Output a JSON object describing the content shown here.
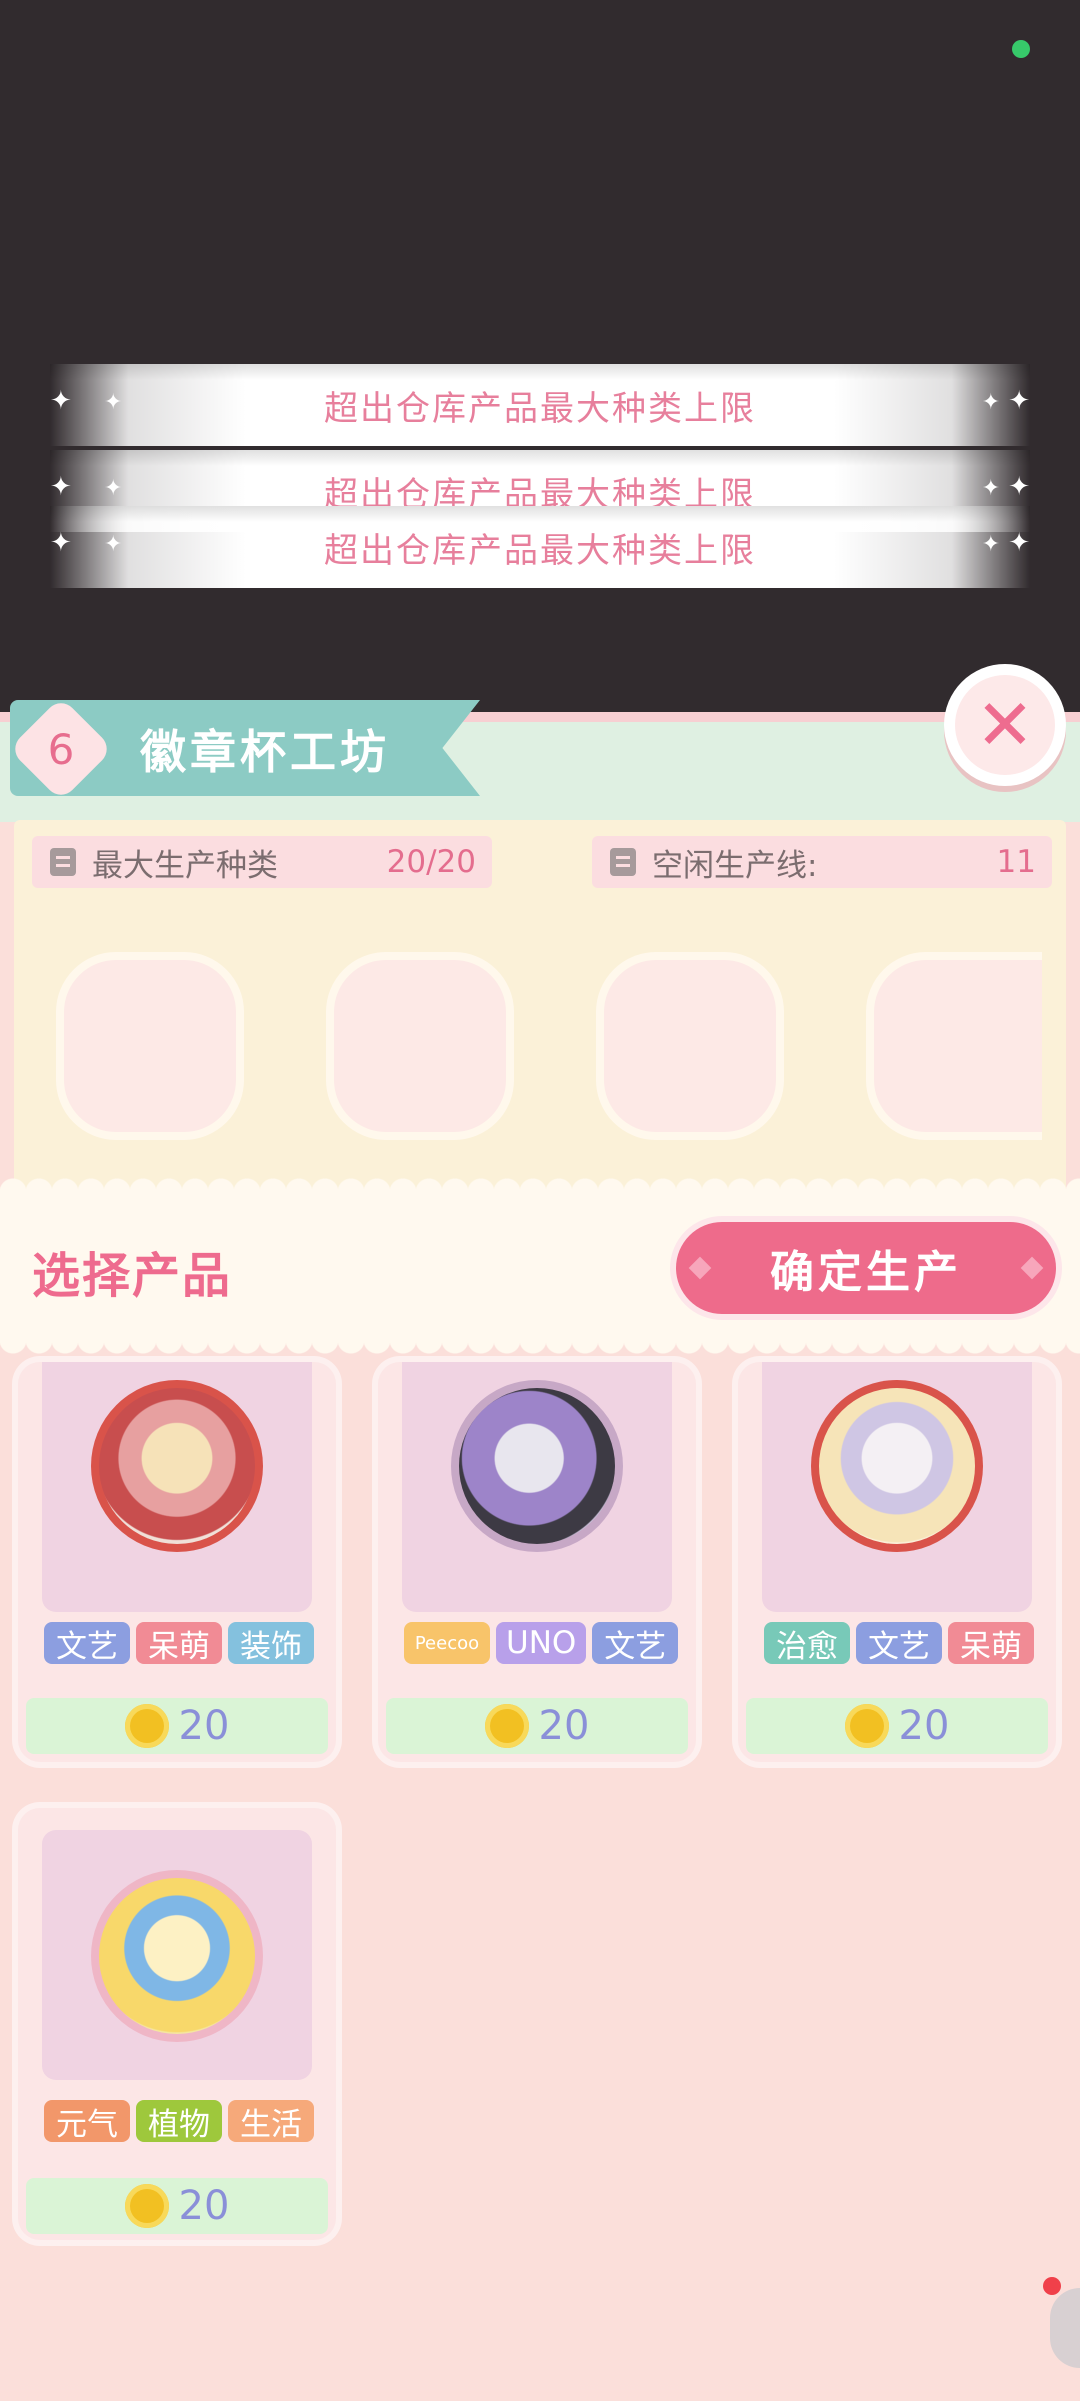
{
  "toasts": [
    {
      "text": "超出仓库产品最大种类上限"
    },
    {
      "text": "超出仓库产品最大种类上限"
    },
    {
      "text": "超出仓库产品最大种类上限"
    }
  ],
  "header": {
    "level": "6",
    "title": "徽章杯工坊",
    "close_icon": "close-icon"
  },
  "info": {
    "max_types_label": "最大生产种类",
    "max_types_value": "20/20",
    "idle_lines_label": "空闲生产线:",
    "idle_lines_value": "11"
  },
  "select": {
    "label": "选择产品",
    "confirm_label": "确定生产"
  },
  "products": [
    {
      "tags": [
        "文艺",
        "呆萌",
        "装饰"
      ],
      "tag_colors": [
        "#8c9ee0",
        "#f18b95",
        "#84c1de"
      ],
      "price": "20"
    },
    {
      "tags": [
        "Peecoo",
        "UNO",
        "文艺"
      ],
      "tag_colors": [
        "#f8c46a",
        "#b8a0ea",
        "#8c9ee0"
      ],
      "price": "20"
    },
    {
      "tags": [
        "治愈",
        "文艺",
        "呆萌"
      ],
      "tag_colors": [
        "#78c9b8",
        "#8c9ee0",
        "#f18b95"
      ],
      "price": "20"
    },
    {
      "tags": [
        "元气",
        "植物",
        "生活"
      ],
      "tag_colors": [
        "#f2976a",
        "#9ec83c",
        "#f6a97a"
      ],
      "price": "20"
    }
  ],
  "colors": {
    "accent": "#ee6b8b",
    "banner": "#8ccbc4",
    "price_text": "#8a8fd8"
  }
}
